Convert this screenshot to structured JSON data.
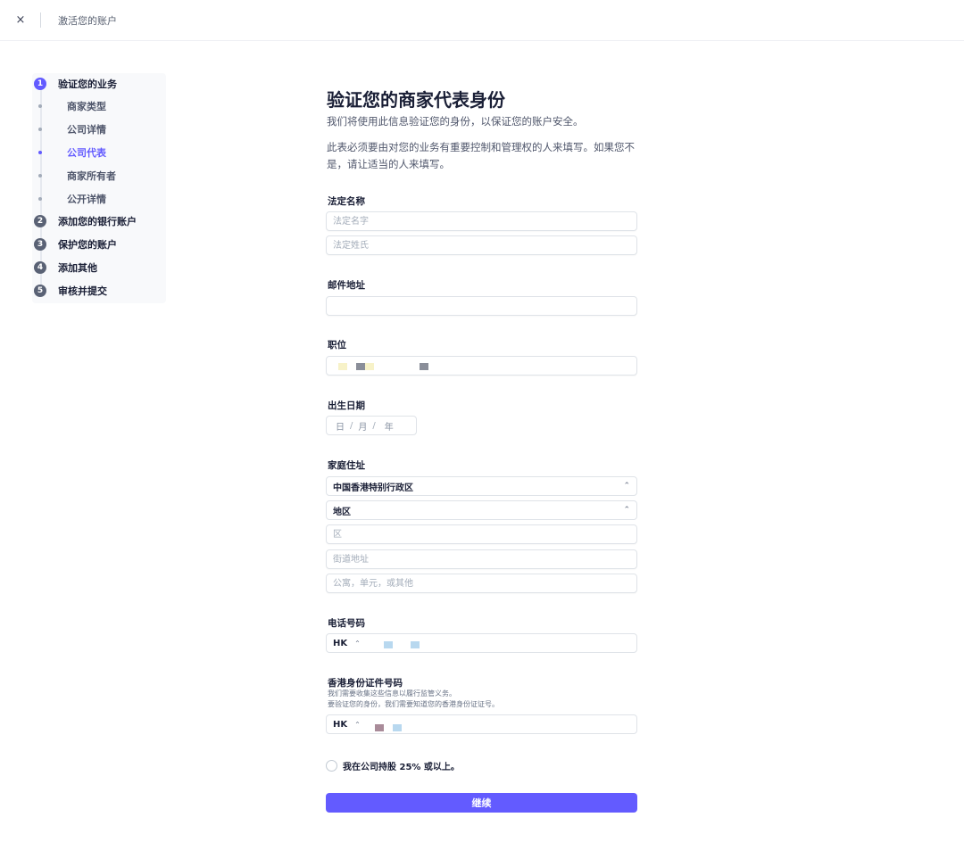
{
  "header": {
    "close_icon": "×",
    "title": "激活您的账户"
  },
  "sidebar": {
    "steps": [
      {
        "num": "1",
        "label": "验证您的业务"
      },
      {
        "num": "2",
        "label": "添加您的银行账户"
      },
      {
        "num": "3",
        "label": "保护您的账户"
      },
      {
        "num": "4",
        "label": "添加其他"
      },
      {
        "num": "5",
        "label": "审核并提交"
      }
    ],
    "substeps": [
      {
        "label": "商家类型"
      },
      {
        "label": "公司详情"
      },
      {
        "label": "公司代表",
        "active": true
      },
      {
        "label": "商家所有者"
      },
      {
        "label": "公开详情"
      }
    ]
  },
  "form": {
    "title": "验证您的商家代表身份",
    "subtitle": "我们将使用此信息验证您的身份，以保证您的账户安全。",
    "description": "此表必须要由对您的业务有重要控制和管理权的人来填写。如果您不是，请让适当的人来填写。",
    "legal_name": {
      "label": "法定名称",
      "first_placeholder": "法定名字",
      "last_placeholder": "法定姓氏"
    },
    "email": {
      "label": "邮件地址",
      "value": ""
    },
    "job_title": {
      "label": "职位"
    },
    "dob": {
      "label": "出生日期",
      "day": "日",
      "month": "月",
      "year": "年",
      "sep": "/"
    },
    "address": {
      "label": "家庭住址",
      "country": "中国香港特别行政区",
      "region": "地区",
      "district_placeholder": "区",
      "street_placeholder": "街道地址",
      "unit_placeholder": "公寓，单元，或其他"
    },
    "phone": {
      "label": "电话号码",
      "country_code": "HK"
    },
    "hkid": {
      "label": "香港身份证件号码",
      "hint_line1": "我们需要收集这些信息以履行监管义务。",
      "hint_line2": "要验证您的身份，我们需要知道您的香港身份证证号。",
      "country_code": "HK"
    },
    "ownership_checkbox": "我在公司持股 25% 或以上。",
    "submit_label": "继续"
  },
  "colors": {
    "accent": "#635bff",
    "text": "#1a1f36",
    "muted": "#4f566b",
    "border": "#dfe3e8"
  }
}
